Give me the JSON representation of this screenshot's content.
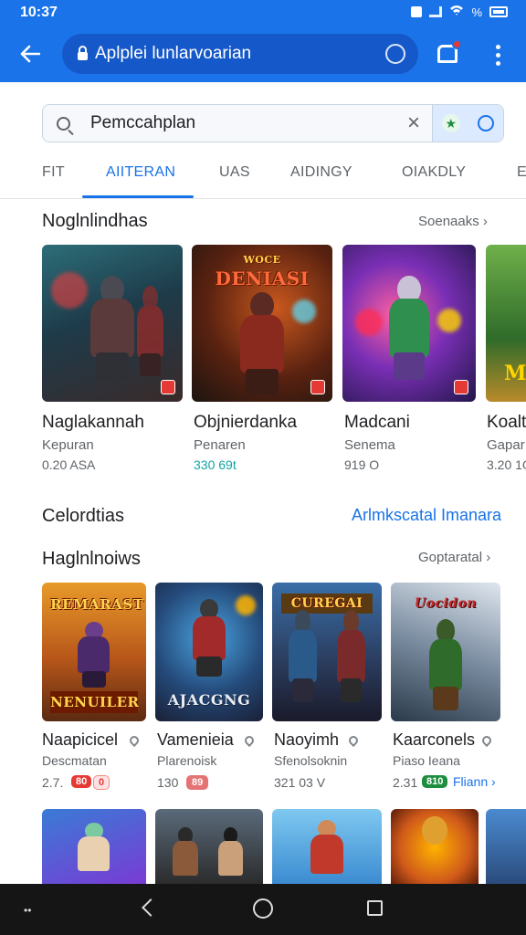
{
  "status_bar": {
    "time": "10:37",
    "right_text": "%"
  },
  "browser": {
    "url": "Aplplei lunlarvoarian"
  },
  "search": {
    "value": "Pemccahplan"
  },
  "tabs": [
    "FIT",
    "AIITERAN",
    "UAS",
    "AIDINGY",
    "OIAKDLY",
    "E"
  ],
  "section1": {
    "title": "Noglnlindhas",
    "link": "Soenaaks",
    "cards": [
      {
        "title": "Naglakannah",
        "subtitle": "Kepuran",
        "meta": "0.20 ASA"
      },
      {
        "title": "Objnierdanka",
        "subtitle": "Penaren",
        "meta": "330 69t"
      },
      {
        "title": "Madcani",
        "subtitle": "Senema",
        "meta": "919 O"
      },
      {
        "title": "Koalt",
        "subtitle": "Gapar",
        "meta": "3.20 1G"
      }
    ]
  },
  "section2": {
    "title": "Celordtias",
    "link": "Arlmkscatal Imanara"
  },
  "section3": {
    "title": "Haglnlnoiws",
    "link": "Goptaratal",
    "cards": [
      {
        "title": "Naapicicel",
        "subtitle": "Descmatan",
        "meta": "2.7.",
        "chip": "80",
        "chip2": "0",
        "banner": "REMARAST",
        "banner2": "NENUILER"
      },
      {
        "title": "Vamenieia",
        "subtitle": "Plarenoisk",
        "meta": "130",
        "chip": "89",
        "banner": "AJACGNG"
      },
      {
        "title": "Naoyimh",
        "subtitle": "Sfenolsoknin",
        "meta": "321 03 V",
        "banner": "CUREGAI"
      },
      {
        "title": "Kaarconels",
        "subtitle": "Piaso Ieana",
        "meta": "2.31",
        "chip": "810",
        "more": "Fliann"
      }
    ]
  },
  "section1_banners": {
    "card2": "DENIASI",
    "card2_small": "WOCE"
  },
  "colors": {
    "accent": "#1a73e8",
    "appbar": "#1a73e8",
    "teal": "#12a4a4",
    "chip_red": "#e53935",
    "chip_green": "#1e8e3e"
  },
  "icons": [
    "back-arrow-icon",
    "lock-icon",
    "tab-switcher-icon",
    "account-icon",
    "more-vert-icon",
    "search-icon",
    "close-icon",
    "star-badge-icon",
    "voice-ring-icon",
    "chevron-right-icon",
    "pin-icon"
  ]
}
